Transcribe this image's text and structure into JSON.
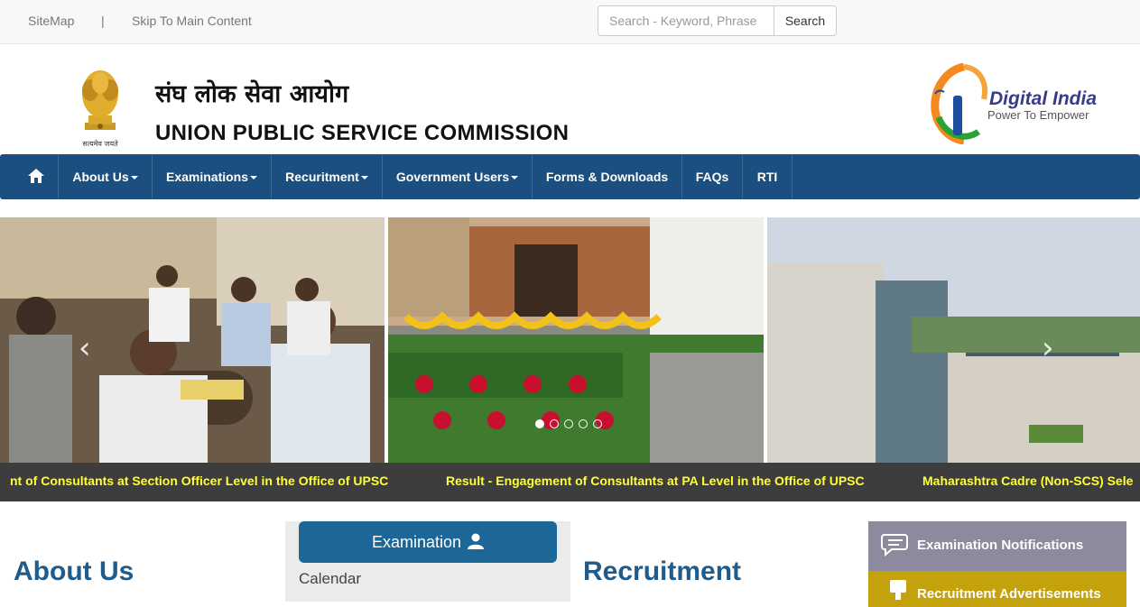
{
  "topbar": {
    "sitemap": "SiteMap",
    "separator": "|",
    "skip": "Skip To Main Content",
    "search_placeholder": "Search - Keyword, Phrase",
    "search_button": "Search"
  },
  "header": {
    "hindi_title": "संघ लोक सेवा आयोग",
    "english_title": "UNION PUBLIC SERVICE COMMISSION",
    "emblem_motto": "सत्यमेव जयते",
    "digital_india_title": "Digital India",
    "digital_india_tagline": "Power To Empower"
  },
  "nav": {
    "items": [
      {
        "label": "About Us"
      },
      {
        "label": "Examinations"
      },
      {
        "label": "Recuritment"
      },
      {
        "label": "Government Users"
      },
      {
        "label": "Forms & Downloads"
      },
      {
        "label": "FAQs"
      },
      {
        "label": "RTI"
      }
    ]
  },
  "slider": {
    "total_slides": 5,
    "active_slide": 1
  },
  "ticker": {
    "items": [
      "nt of Consultants at Section Officer Level in the Office of UPSC",
      "Result - Engagement of Consultants at PA Level in the Office of UPSC",
      "Maharashtra Cadre (Non-SCS) Sele"
    ]
  },
  "sections": {
    "about_heading": "About Us",
    "exam_button": "Examination",
    "calendar": "Calendar",
    "recruit_heading": "Recruitment",
    "notifications": "Examination Notifications",
    "advertisements": "Recruitment Advertisements"
  },
  "colors": {
    "nav_bg": "#1b4f80",
    "ticker_bg": "#3d3d3d",
    "ticker_text": "#ffff33",
    "heading": "#1f5b8b",
    "exam_button": "#1c6698",
    "notif_box": "#8c8a9c",
    "adv_box": "#c3a20e"
  }
}
